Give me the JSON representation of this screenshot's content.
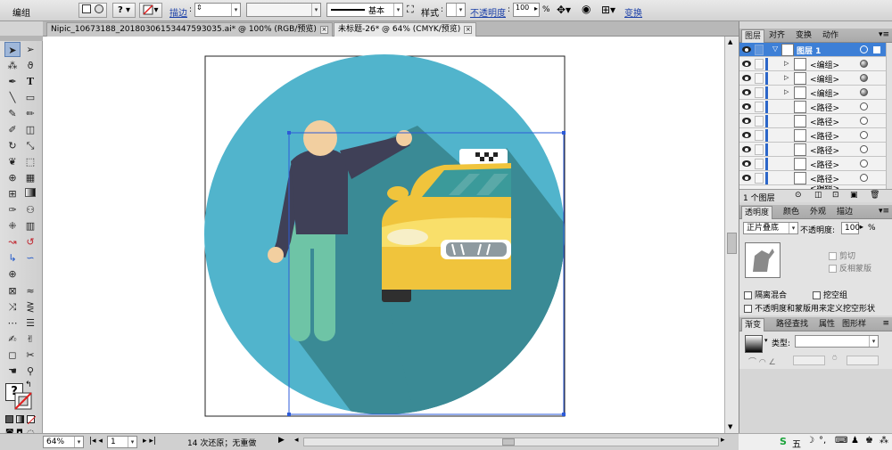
{
  "control_bar": {
    "group_label": "编组",
    "stroke_label": "描边",
    "stroke_style_label": "基本",
    "style_label": "样式",
    "opacity_label": "不透明度",
    "opacity_value": "100",
    "opacity_unit": "%",
    "transform_label": "变换"
  },
  "tabs": [
    {
      "label": "Nipic_10673188_20180306153447593035.ai* @ 100% (RGB/预览)",
      "active": false
    },
    {
      "label": "未标题-26* @ 64% (CMYK/预览)",
      "active": true
    }
  ],
  "status": {
    "zoom": "64%",
    "page": "1",
    "undo_text": "14 次还原；无重做"
  },
  "layers_panel": {
    "tabs": [
      "图层",
      "对齐",
      "变换",
      "动作"
    ],
    "layer_name": "图层 1",
    "items": [
      {
        "name": "<编组>",
        "expand": true,
        "target": "filled"
      },
      {
        "name": "<编组>",
        "expand": true,
        "target": "filled"
      },
      {
        "name": "<编组>",
        "expand": true,
        "target": "filled"
      },
      {
        "name": "<路径>",
        "expand": false,
        "target": "empty"
      },
      {
        "name": "<路径>",
        "expand": false,
        "target": "empty"
      },
      {
        "name": "<路径>",
        "expand": false,
        "target": "empty"
      },
      {
        "name": "<路径>",
        "expand": false,
        "target": "empty"
      },
      {
        "name": "<路径>",
        "expand": false,
        "target": "empty"
      },
      {
        "name": "<路径>",
        "expand": false,
        "target": "empty"
      }
    ],
    "partial_item": "<编组>",
    "footer_count": "1 个图层"
  },
  "transparency_panel": {
    "tabs": [
      "透明度",
      "颜色",
      "外观",
      "描边"
    ],
    "blend_mode": "正片叠底",
    "opacity_label": "不透明度:",
    "opacity_value": "100",
    "opacity_unit": "%",
    "clip_label": "剪切",
    "invert_mask_label": "反相蒙版",
    "isolate_blending": "隔离混合",
    "knockout_group": "挖空组",
    "opacity_mask_define": "不透明度和蒙版用来定义挖空形状"
  },
  "gradient_panel": {
    "tabs": [
      "渐变",
      "路径查找",
      "属性",
      "图形样"
    ],
    "type_label": "类型:"
  },
  "tray": {
    "ime_label": "五"
  },
  "colors": {
    "circle": "#51b4cc",
    "shadow": "#3a8a95",
    "jacket": "#3f4057",
    "pants": "#6ec4a6",
    "skin": "#f2cfa0",
    "taxi_body": "#f0c43c",
    "taxi_light": "#f9df6a",
    "taxi_window": "#3b9a9a",
    "tire": "#2f2f2f",
    "selection": "#2d5bd8",
    "highlight_row": "#3d7fd6"
  }
}
